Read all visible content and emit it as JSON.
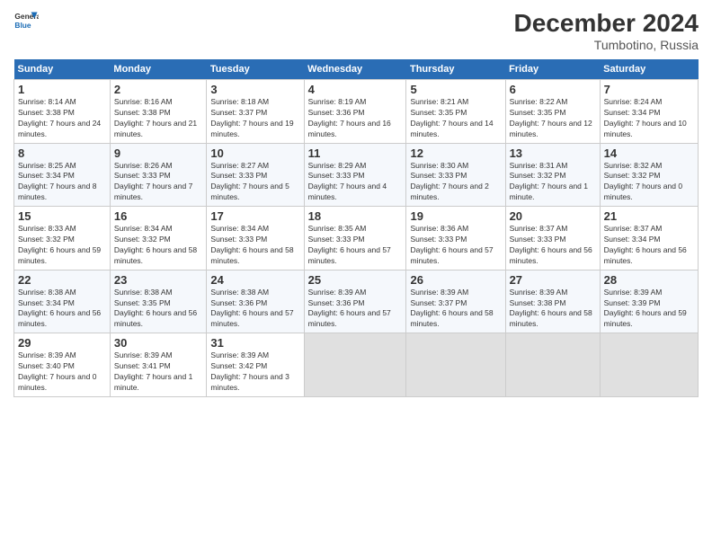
{
  "header": {
    "logo_line1": "General",
    "logo_line2": "Blue",
    "main_title": "December 2024",
    "subtitle": "Tumbotino, Russia"
  },
  "days_of_week": [
    "Sunday",
    "Monday",
    "Tuesday",
    "Wednesday",
    "Thursday",
    "Friday",
    "Saturday"
  ],
  "weeks": [
    [
      {
        "day": "1",
        "sunrise": "Sunrise: 8:14 AM",
        "sunset": "Sunset: 3:38 PM",
        "daylight": "Daylight: 7 hours and 24 minutes."
      },
      {
        "day": "2",
        "sunrise": "Sunrise: 8:16 AM",
        "sunset": "Sunset: 3:38 PM",
        "daylight": "Daylight: 7 hours and 21 minutes."
      },
      {
        "day": "3",
        "sunrise": "Sunrise: 8:18 AM",
        "sunset": "Sunset: 3:37 PM",
        "daylight": "Daylight: 7 hours and 19 minutes."
      },
      {
        "day": "4",
        "sunrise": "Sunrise: 8:19 AM",
        "sunset": "Sunset: 3:36 PM",
        "daylight": "Daylight: 7 hours and 16 minutes."
      },
      {
        "day": "5",
        "sunrise": "Sunrise: 8:21 AM",
        "sunset": "Sunset: 3:35 PM",
        "daylight": "Daylight: 7 hours and 14 minutes."
      },
      {
        "day": "6",
        "sunrise": "Sunrise: 8:22 AM",
        "sunset": "Sunset: 3:35 PM",
        "daylight": "Daylight: 7 hours and 12 minutes."
      },
      {
        "day": "7",
        "sunrise": "Sunrise: 8:24 AM",
        "sunset": "Sunset: 3:34 PM",
        "daylight": "Daylight: 7 hours and 10 minutes."
      }
    ],
    [
      {
        "day": "8",
        "sunrise": "Sunrise: 8:25 AM",
        "sunset": "Sunset: 3:34 PM",
        "daylight": "Daylight: 7 hours and 8 minutes."
      },
      {
        "day": "9",
        "sunrise": "Sunrise: 8:26 AM",
        "sunset": "Sunset: 3:33 PM",
        "daylight": "Daylight: 7 hours and 7 minutes."
      },
      {
        "day": "10",
        "sunrise": "Sunrise: 8:27 AM",
        "sunset": "Sunset: 3:33 PM",
        "daylight": "Daylight: 7 hours and 5 minutes."
      },
      {
        "day": "11",
        "sunrise": "Sunrise: 8:29 AM",
        "sunset": "Sunset: 3:33 PM",
        "daylight": "Daylight: 7 hours and 4 minutes."
      },
      {
        "day": "12",
        "sunrise": "Sunrise: 8:30 AM",
        "sunset": "Sunset: 3:33 PM",
        "daylight": "Daylight: 7 hours and 2 minutes."
      },
      {
        "day": "13",
        "sunrise": "Sunrise: 8:31 AM",
        "sunset": "Sunset: 3:32 PM",
        "daylight": "Daylight: 7 hours and 1 minute."
      },
      {
        "day": "14",
        "sunrise": "Sunrise: 8:32 AM",
        "sunset": "Sunset: 3:32 PM",
        "daylight": "Daylight: 7 hours and 0 minutes."
      }
    ],
    [
      {
        "day": "15",
        "sunrise": "Sunrise: 8:33 AM",
        "sunset": "Sunset: 3:32 PM",
        "daylight": "Daylight: 6 hours and 59 minutes."
      },
      {
        "day": "16",
        "sunrise": "Sunrise: 8:34 AM",
        "sunset": "Sunset: 3:32 PM",
        "daylight": "Daylight: 6 hours and 58 minutes."
      },
      {
        "day": "17",
        "sunrise": "Sunrise: 8:34 AM",
        "sunset": "Sunset: 3:33 PM",
        "daylight": "Daylight: 6 hours and 58 minutes."
      },
      {
        "day": "18",
        "sunrise": "Sunrise: 8:35 AM",
        "sunset": "Sunset: 3:33 PM",
        "daylight": "Daylight: 6 hours and 57 minutes."
      },
      {
        "day": "19",
        "sunrise": "Sunrise: 8:36 AM",
        "sunset": "Sunset: 3:33 PM",
        "daylight": "Daylight: 6 hours and 57 minutes."
      },
      {
        "day": "20",
        "sunrise": "Sunrise: 8:37 AM",
        "sunset": "Sunset: 3:33 PM",
        "daylight": "Daylight: 6 hours and 56 minutes."
      },
      {
        "day": "21",
        "sunrise": "Sunrise: 8:37 AM",
        "sunset": "Sunset: 3:34 PM",
        "daylight": "Daylight: 6 hours and 56 minutes."
      }
    ],
    [
      {
        "day": "22",
        "sunrise": "Sunrise: 8:38 AM",
        "sunset": "Sunset: 3:34 PM",
        "daylight": "Daylight: 6 hours and 56 minutes."
      },
      {
        "day": "23",
        "sunrise": "Sunrise: 8:38 AM",
        "sunset": "Sunset: 3:35 PM",
        "daylight": "Daylight: 6 hours and 56 minutes."
      },
      {
        "day": "24",
        "sunrise": "Sunrise: 8:38 AM",
        "sunset": "Sunset: 3:36 PM",
        "daylight": "Daylight: 6 hours and 57 minutes."
      },
      {
        "day": "25",
        "sunrise": "Sunrise: 8:39 AM",
        "sunset": "Sunset: 3:36 PM",
        "daylight": "Daylight: 6 hours and 57 minutes."
      },
      {
        "day": "26",
        "sunrise": "Sunrise: 8:39 AM",
        "sunset": "Sunset: 3:37 PM",
        "daylight": "Daylight: 6 hours and 58 minutes."
      },
      {
        "day": "27",
        "sunrise": "Sunrise: 8:39 AM",
        "sunset": "Sunset: 3:38 PM",
        "daylight": "Daylight: 6 hours and 58 minutes."
      },
      {
        "day": "28",
        "sunrise": "Sunrise: 8:39 AM",
        "sunset": "Sunset: 3:39 PM",
        "daylight": "Daylight: 6 hours and 59 minutes."
      }
    ],
    [
      {
        "day": "29",
        "sunrise": "Sunrise: 8:39 AM",
        "sunset": "Sunset: 3:40 PM",
        "daylight": "Daylight: 7 hours and 0 minutes."
      },
      {
        "day": "30",
        "sunrise": "Sunrise: 8:39 AM",
        "sunset": "Sunset: 3:41 PM",
        "daylight": "Daylight: 7 hours and 1 minute."
      },
      {
        "day": "31",
        "sunrise": "Sunrise: 8:39 AM",
        "sunset": "Sunset: 3:42 PM",
        "daylight": "Daylight: 7 hours and 3 minutes."
      },
      null,
      null,
      null,
      null
    ]
  ]
}
